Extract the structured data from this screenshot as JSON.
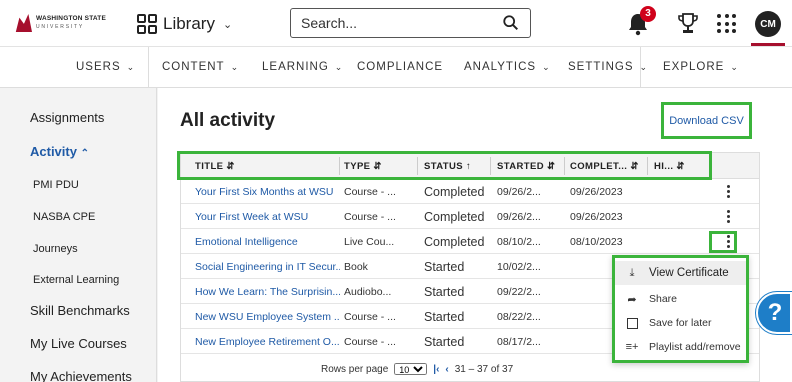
{
  "header": {
    "logo_line1": "WASHINGTON STATE",
    "logo_line2": "UNIVERSITY",
    "library_label": "Library",
    "search_placeholder": "Search...",
    "notifications_count": "3",
    "avatar_initials": "CM"
  },
  "nav": {
    "items": [
      {
        "label": "USERS",
        "chevron": true
      },
      {
        "label": "CONTENT",
        "chevron": true
      },
      {
        "label": "LEARNING",
        "chevron": true
      },
      {
        "label": "COMPLIANCE",
        "chevron": false
      },
      {
        "label": "ANALYTICS",
        "chevron": true
      },
      {
        "label": "SETTINGS",
        "chevron": true
      },
      {
        "label": "EXPLORE",
        "chevron": true
      }
    ]
  },
  "sidebar": {
    "items": [
      {
        "label": "Assignments"
      },
      {
        "label": "Activity"
      },
      {
        "label": "PMI PDU"
      },
      {
        "label": "NASBA CPE"
      },
      {
        "label": "Journeys"
      },
      {
        "label": "External Learning"
      },
      {
        "label": "Skill Benchmarks"
      },
      {
        "label": "My Live Courses"
      },
      {
        "label": "My Achievements"
      }
    ]
  },
  "main": {
    "title": "All activity",
    "download_label": "Download CSV",
    "columns": [
      "TITLE",
      "TYPE",
      "STATUS",
      "STARTED",
      "COMPLET...",
      "HI..."
    ],
    "rows": [
      {
        "title": "Your First Six Months at WSU",
        "type": "Course - ...",
        "status": "Completed",
        "started": "09/26/2...",
        "completed": "09/26/2023"
      },
      {
        "title": "Your First Week at WSU",
        "type": "Course - ...",
        "status": "Completed",
        "started": "09/26/2...",
        "completed": "09/26/2023"
      },
      {
        "title": "Emotional Intelligence",
        "type": "Live Cou...",
        "status": "Completed",
        "started": "08/10/2...",
        "completed": "08/10/2023"
      },
      {
        "title": "Social Engineering in IT Secur...",
        "type": "Book",
        "status": "Started",
        "started": "10/02/2...",
        "completed": ""
      },
      {
        "title": "How We Learn: The Surprisin...",
        "type": "Audiobo...",
        "status": "Started",
        "started": "09/22/2...",
        "completed": ""
      },
      {
        "title": "New WSU Employee System ...",
        "type": "Course - ...",
        "status": "Started",
        "started": "08/22/2...",
        "completed": ""
      },
      {
        "title": "New Employee Retirement O...",
        "type": "Course - ...",
        "status": "Started",
        "started": "08/17/2...",
        "completed": ""
      }
    ],
    "pager": {
      "rows_per_page_label": "Rows per page",
      "rows_per_page_value": "10",
      "range": "31 – 37 of 37"
    }
  },
  "context_menu": {
    "items": [
      {
        "label": "View Certificate"
      },
      {
        "label": "Share"
      },
      {
        "label": "Save for later"
      },
      {
        "label": "Playlist add/remove"
      }
    ]
  },
  "help_label": "?",
  "colors": {
    "accent": "#a60f2d",
    "link": "#1f5aa6",
    "highlight": "#3bb43b",
    "help": "#1e7ec8"
  }
}
